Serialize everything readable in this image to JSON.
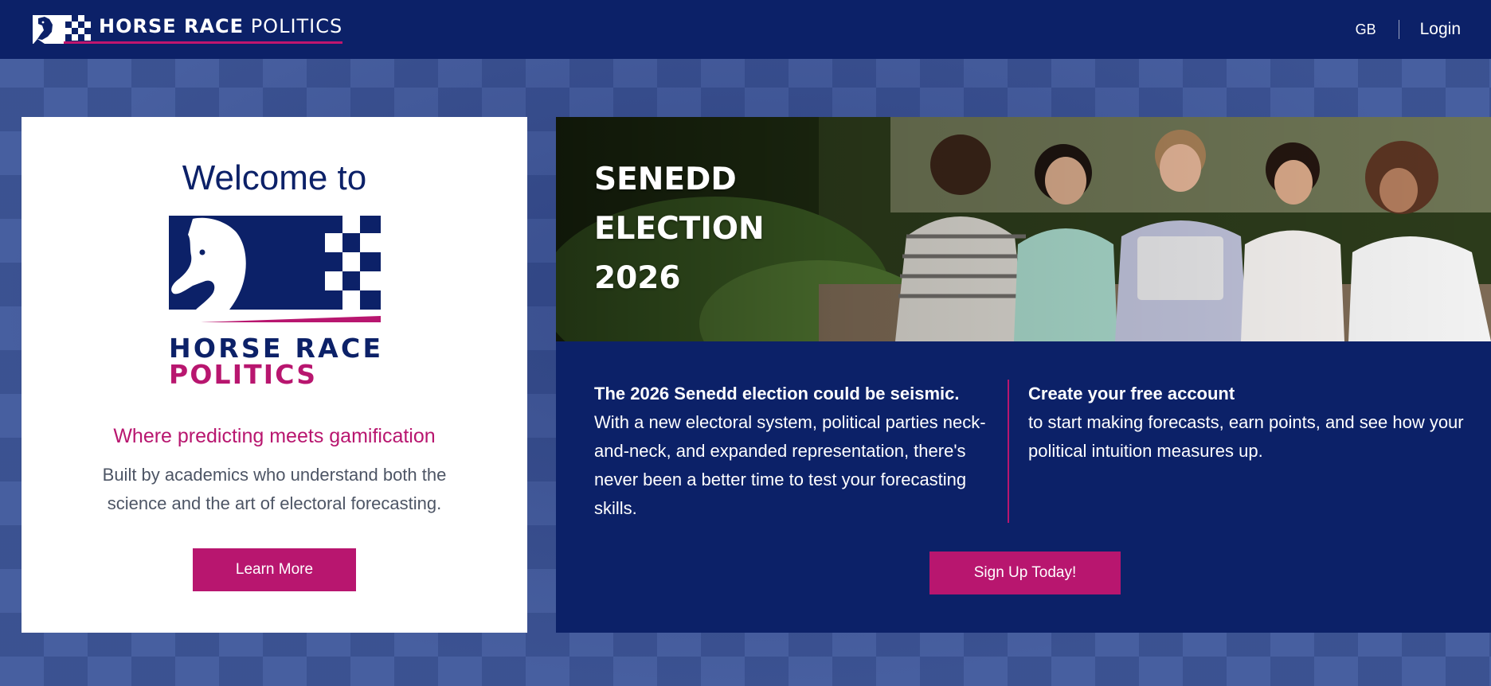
{
  "header": {
    "brand_bold": "HORSE RACE",
    "brand_light": " POLITICS",
    "region": "GB",
    "login_label": "Login"
  },
  "welcome": {
    "title": "Welcome to",
    "logo_line1": "HORSE RACE",
    "logo_line2": "POLITICS",
    "tagline": "Where predicting meets gamification",
    "description": "Built by academics who understand both the science and the art of electoral forecasting.",
    "button_label": "Learn More"
  },
  "election": {
    "hero_title": "SENEDD ELECTION 2026",
    "left_heading": "The 2026 Senedd election could be seismic.",
    "left_body": "With a new electoral system, political parties neck-and-neck, and expanded representation, there's never been a better time to test your forecasting skills.",
    "right_heading": "Create your free account",
    "right_body": "to start making forecasts, earn points, and see how your political intuition measures up.",
    "button_label": "Sign Up Today!"
  },
  "colors": {
    "navy": "#0c2168",
    "magenta": "#b8166f",
    "background": "#3d5494"
  },
  "icons": {
    "brand": "horse-chess-knight-icon",
    "hero": "students-photo"
  }
}
